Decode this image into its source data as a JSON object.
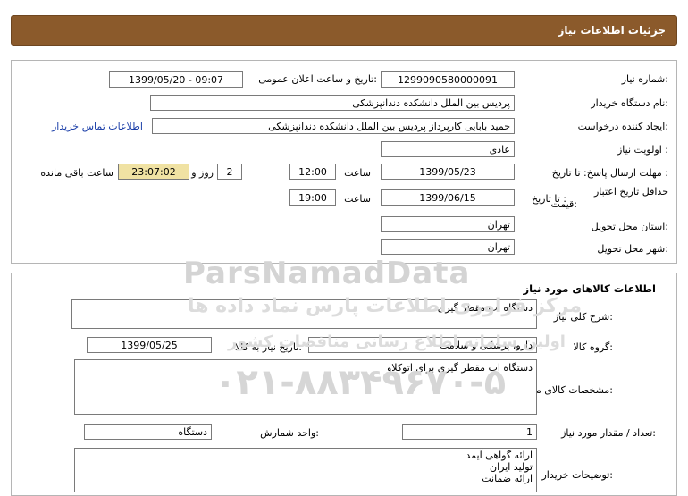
{
  "window": {
    "title": "جزئیات اطلاعات نیاز"
  },
  "info": {
    "need_number_label": "شماره نیاز:",
    "need_number": "1299090580000091",
    "announce_label": "تاریخ و ساعت اعلان عمومی:",
    "announce_value": "1399/05/20 - 09:07",
    "buyer_org_label": "نام دستگاه خریدار:",
    "buyer_org": "پردیس بین الملل دانشکده دندانپزشکی",
    "requester_label": "ایجاد کننده درخواست:",
    "requester": "حمید بابایی کارپرداز پردیس بین الملل دانشکده دندانپزشکی",
    "contact_link": "اطلاعات تماس خریدار",
    "priority_label": "اولویت نیاز :",
    "priority": "عادی",
    "deadline_label": "مهلت ارسال پاسخ: تا تاریخ :",
    "deadline_date": "1399/05/23",
    "time_label": "ساعت",
    "deadline_time": "12:00",
    "days_value": "2",
    "days_label": "روز و",
    "remaining_time": "23:07:02",
    "remaining_label": "ساعت باقی مانده",
    "validity_label_1": "حداقل تاریخ اعتبار",
    "validity_label_2": "قیمت:",
    "validity_to_label": "تا تاریخ :",
    "validity_date": "1399/06/15",
    "validity_time_label": "ساعت",
    "validity_time": "19:00",
    "province_label": "استان محل تحویل:",
    "province": "تهران",
    "city_label": "شهر محل تحویل:",
    "city": "تهران"
  },
  "goods": {
    "section_title": "اطلاعات کالاهای مورد نیاز",
    "summary_label": "شرح کلی نیاز:",
    "summary": "دستگاه اب مقطر گیری",
    "group_label": "گروه کالا:",
    "group": "دارو، پزشکی و سلامت",
    "need_date_label": "تاریخ نیاز به کالا:",
    "need_date": "1399/05/25",
    "specs_label": "مشخصات کالای مورد نیاز:",
    "specs": "دستگاه اب مقطر گیری برای اتوکلاو",
    "qty_label": "تعداد / مقدار مورد نیاز:",
    "qty": "1",
    "unit_label": "واحد شمارش:",
    "unit": "دستگاه",
    "buyer_notes_label": "توضیحات خریدار:",
    "buyer_notes": "ارائه گواهی آیمد\nتولید ایران\nارائه ضمانت"
  },
  "watermark": {
    "line1": "ParsNamadData",
    "line2": "مرکز فراوری اطلاعات پارس نماد داده ها",
    "line3": "اولین سامانه اطلاع رسانی مناقصات کشور",
    "line4": "۰۲۱-۸۸۳۴۹۶۷۰-۵"
  },
  "colors": {
    "title_bar": "#8b5a2b",
    "remaining_bg": "#f0e2a3",
    "link": "#1a3ea8"
  }
}
